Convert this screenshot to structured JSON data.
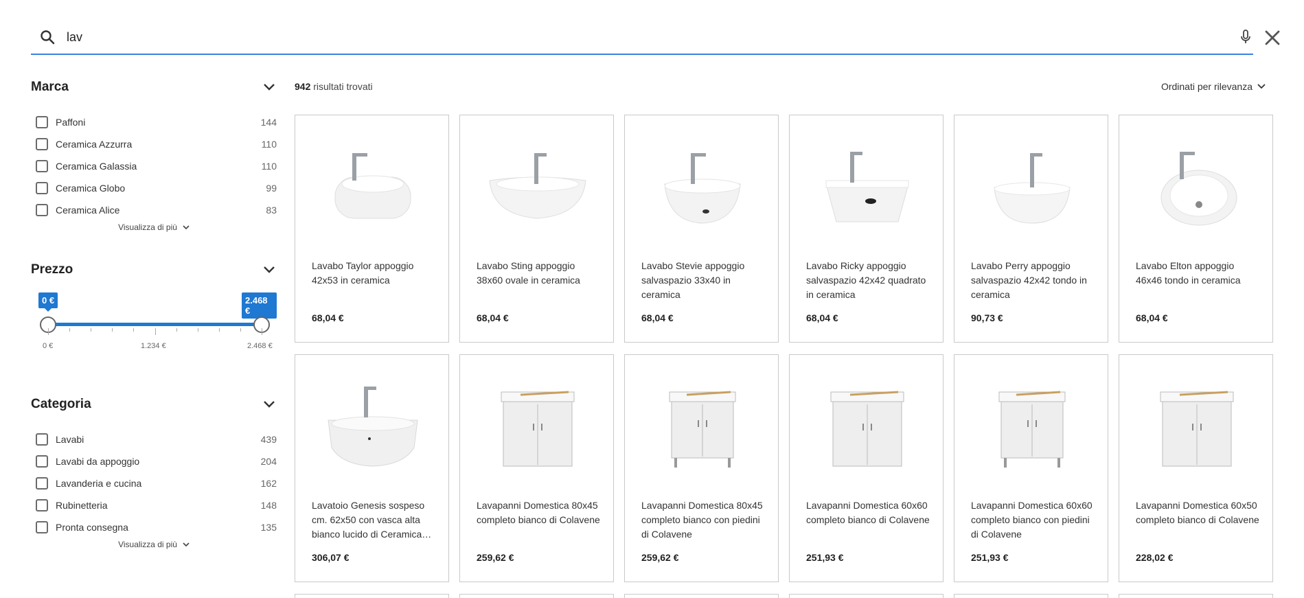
{
  "search": {
    "query": "lav",
    "icon": "search-icon",
    "mic_icon": "mic-icon",
    "close_icon": "close-icon"
  },
  "sidebar": {
    "brand": {
      "title": "Marca",
      "items": [
        {
          "label": "Paffoni",
          "count": "144"
        },
        {
          "label": "Ceramica Azzurra",
          "count": "110"
        },
        {
          "label": "Ceramica Galassia",
          "count": "110"
        },
        {
          "label": "Ceramica Globo",
          "count": "99"
        },
        {
          "label": "Ceramica Alice",
          "count": "83"
        }
      ],
      "show_more": "Visualizza di più"
    },
    "price": {
      "title": "Prezzo",
      "min_value": "0 €",
      "max_value": "2.468 €",
      "tick_min": "0 €",
      "tick_mid": "1.234 €",
      "tick_max": "2.468 €",
      "selected_range_fraction": [
        0,
        1
      ]
    },
    "category": {
      "title": "Categoria",
      "items": [
        {
          "label": "Lavabi",
          "count": "439"
        },
        {
          "label": "Lavabi da appoggio",
          "count": "204"
        },
        {
          "label": "Lavanderia e cucina",
          "count": "162"
        },
        {
          "label": "Rubinetteria",
          "count": "148"
        },
        {
          "label": "Pronta consegna",
          "count": "135"
        }
      ],
      "show_more": "Visualizza di più"
    }
  },
  "results": {
    "count": "942",
    "count_label": "risultati trovati",
    "sort_label": "Ordinati per rilevanza"
  },
  "products": [
    {
      "title": "Lavabo Taylor appoggio 42x53 in ceramica",
      "price": "68,04 €",
      "image": "sink-rounded-square"
    },
    {
      "title": "Lavabo Sting appoggio 38x60 ovale in ceramica",
      "price": "68,04 €",
      "image": "sink-oval"
    },
    {
      "title": "Lavabo Stevie appoggio salvaspazio 33x40 in ceramica",
      "price": "68,04 €",
      "image": "sink-bowl"
    },
    {
      "title": "Lavabo Ricky appoggio salvaspazio 42x42 quadrato in ceramica",
      "price": "68,04 €",
      "image": "sink-square"
    },
    {
      "title": "Lavabo Perry appoggio salvaspazio 42x42 tondo in ceramica",
      "price": "90,73 €",
      "image": "sink-round"
    },
    {
      "title": "Lavabo Elton appoggio 46x46 tondo in ceramica",
      "price": "68,04 €",
      "image": "sink-round-deep"
    },
    {
      "title": "Lavatoio Genesis sospeso cm. 62x50 con vasca alta bianco lucido di Ceramica…",
      "price": "306,07 €",
      "image": "wall-hung-basin"
    },
    {
      "title": "Lavapanni Domestica 80x45 completo bianco di Colavene",
      "price": "259,62 €",
      "image": "laundry-cabinet"
    },
    {
      "title": "Lavapanni Domestica 80x45 completo bianco con piedini di Colavene",
      "price": "259,62 €",
      "image": "laundry-cabinet-legs"
    },
    {
      "title": "Lavapanni Domestica 60x60 completo bianco di Colavene",
      "price": "251,93 €",
      "image": "laundry-cabinet"
    },
    {
      "title": "Lavapanni Domestica 60x60 completo bianco con piedini di Colavene",
      "price": "251,93 €",
      "image": "laundry-cabinet-legs"
    },
    {
      "title": "Lavapanni Domestica 60x50 completo bianco di Colavene",
      "price": "228,02 €",
      "image": "laundry-cabinet"
    }
  ],
  "colors": {
    "accent": "#1f78d1",
    "search_underline": "#3b82e0"
  }
}
